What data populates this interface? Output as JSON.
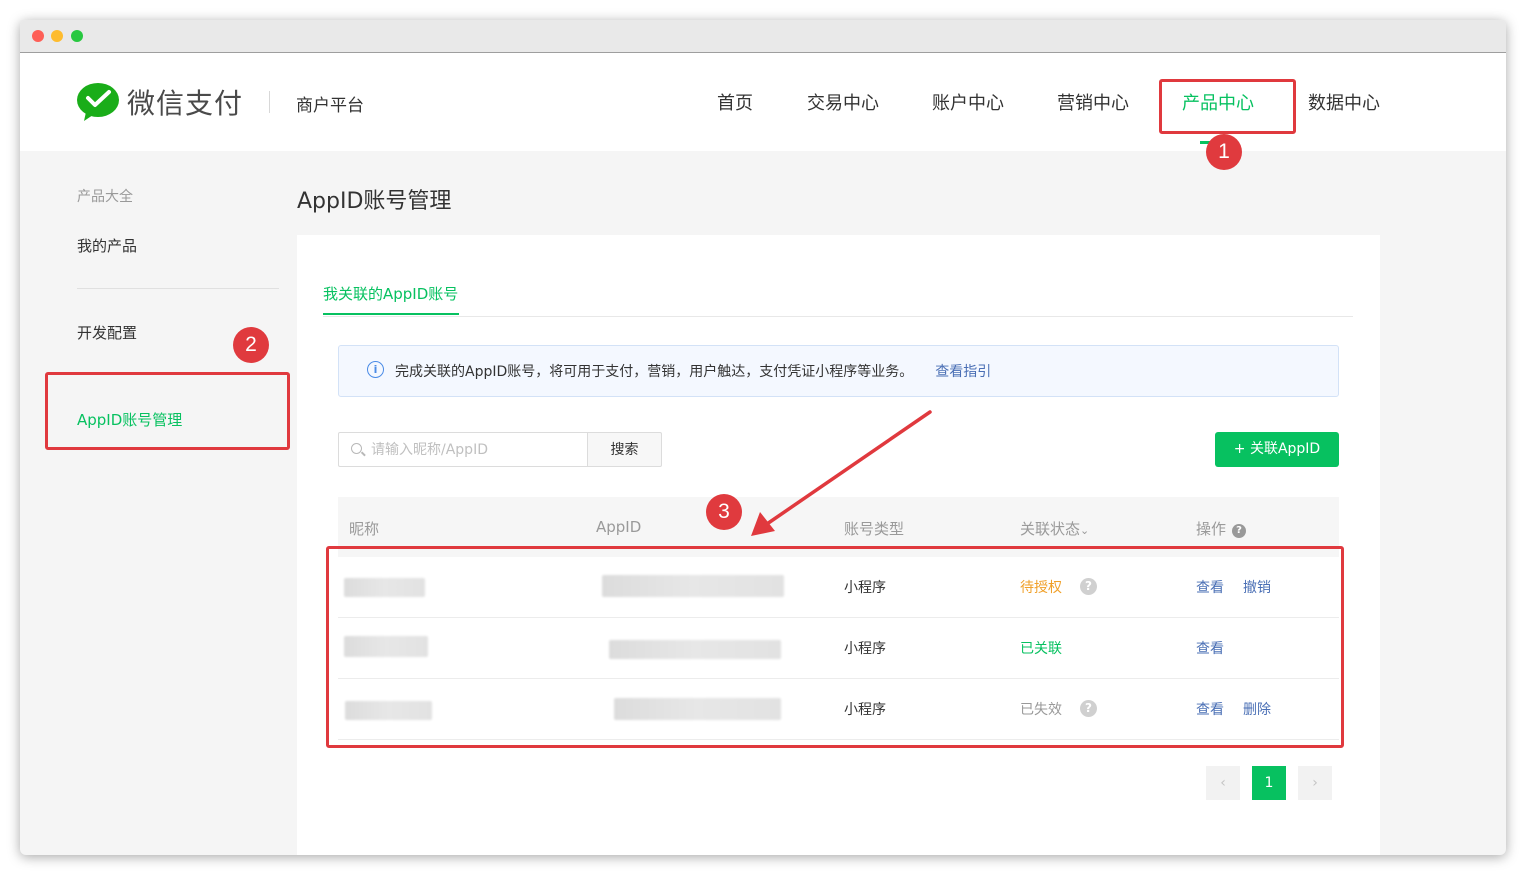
{
  "header": {
    "brand": "微信支付",
    "platform": "商户平台",
    "nav": [
      {
        "label": "首页",
        "active": false
      },
      {
        "label": "交易中心",
        "active": false
      },
      {
        "label": "账户中心",
        "active": false
      },
      {
        "label": "营销中心",
        "active": false
      },
      {
        "label": "产品中心",
        "active": true
      },
      {
        "label": "数据中心",
        "active": false
      }
    ]
  },
  "sidebar": {
    "items": [
      {
        "label": "产品大全"
      },
      {
        "label": "我的产品"
      },
      {
        "label": "开发配置"
      },
      {
        "label": "AppID账号管理",
        "active": true
      }
    ]
  },
  "main": {
    "title": "AppID账号管理",
    "tab": "我关联的AppID账号",
    "info": {
      "text": "完成关联的AppID账号，将可用于支付，营销，用户触达，支付凭证小程序等业务。",
      "link": "查看指引"
    },
    "search": {
      "placeholder": "请输入昵称/AppID",
      "button": "搜索"
    },
    "add_button": "+ 关联AppID",
    "table": {
      "columns": [
        "昵称",
        "AppID",
        "账号类型",
        "关联状态",
        "操作"
      ],
      "status_sort_indicator": "⌄",
      "help_glyph": "?",
      "rows": [
        {
          "type": "小程序",
          "status": "待授权",
          "status_color": "#f0a029",
          "actions": [
            "查看",
            "撤销"
          ]
        },
        {
          "type": "小程序",
          "status": "已关联",
          "status_color": "#07c160",
          "actions": [
            "查看"
          ]
        },
        {
          "type": "小程序",
          "status": "已失效",
          "status_color": "#999999",
          "actions": [
            "查看",
            "删除"
          ]
        }
      ]
    },
    "pagination": {
      "prev": "‹",
      "current": "1",
      "next": "›"
    }
  },
  "annotations": [
    "1",
    "2",
    "3"
  ],
  "colors": {
    "accent": "#07c160",
    "annotation": "#e0393e",
    "link": "#4a6fb5"
  }
}
